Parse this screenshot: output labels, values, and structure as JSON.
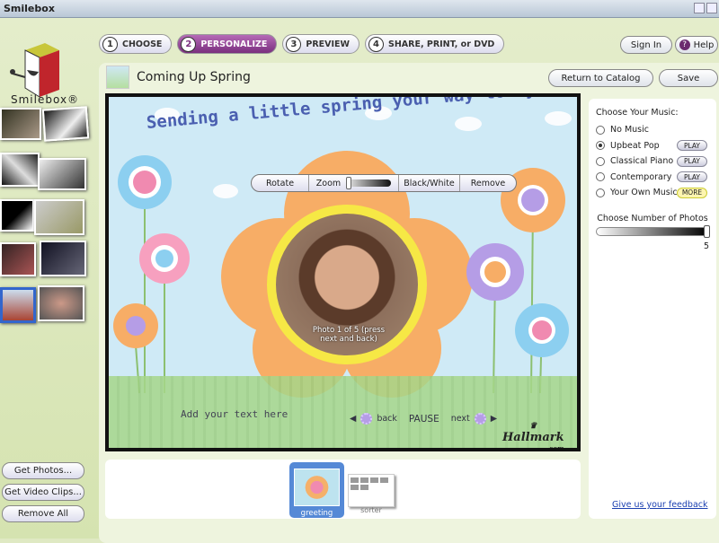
{
  "window": {
    "title": "Smilebox"
  },
  "logo": {
    "text": "Smilebox®"
  },
  "steps": [
    {
      "num": "1",
      "label": "CHOOSE"
    },
    {
      "num": "2",
      "label": "PERSONALIZE",
      "active": true
    },
    {
      "num": "3",
      "label": "PREVIEW"
    },
    {
      "num": "4",
      "label": "SHARE, PRINT, or DVD"
    }
  ],
  "header": {
    "sign_in": "Sign In",
    "help": "Help",
    "return_catalog": "Return to Catalog",
    "save": "Save"
  },
  "template": {
    "title": "Coming Up Spring"
  },
  "card": {
    "headline": "Sending a little spring your way today!",
    "toolbar": {
      "rotate": "Rotate",
      "zoom": "Zoom",
      "bw": "Black/White",
      "remove": "Remove",
      "zoom_level": 0
    },
    "photo_caption": "Photo 1 of 5 (press next and back)",
    "add_text": "Add your text here",
    "nav": {
      "back": "back",
      "pause": "PAUSE",
      "next": "next"
    },
    "brand": "Hallmark",
    "brand_sub": ".com"
  },
  "left": {
    "get_photos": "Get Photos...",
    "get_video": "Get Video Clips...",
    "remove_all": "Remove All"
  },
  "music": {
    "heading": "Choose Your Music:",
    "options": [
      {
        "label": "No Music",
        "selected": false,
        "button": ""
      },
      {
        "label": "Upbeat Pop",
        "selected": true,
        "button": "PLAY"
      },
      {
        "label": "Classical Piano",
        "selected": false,
        "button": "PLAY"
      },
      {
        "label": "Contemporary",
        "selected": false,
        "button": "PLAY"
      },
      {
        "label": "Your Own Music",
        "selected": false,
        "button": "MORE"
      }
    ],
    "photos_heading": "Choose Number of Photos",
    "photos_value": "5",
    "feedback": "Give us your feedback"
  },
  "strip": {
    "greeting": "greeting",
    "sorter": "sorter"
  },
  "colors": {
    "accent": "#7a2f7e",
    "selected_tile": "#5589d6",
    "link": "#1a3fb0"
  }
}
